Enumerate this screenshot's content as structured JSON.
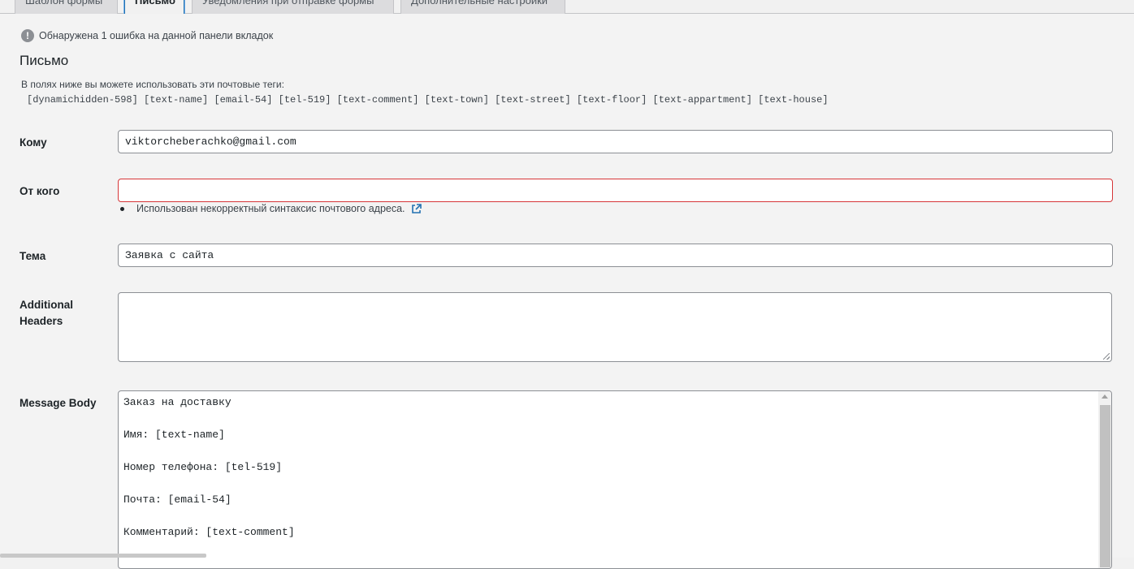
{
  "tabs": [
    {
      "label": "Шаблон формы"
    },
    {
      "label": "Письмо"
    },
    {
      "label": "Уведомления при отправке формы"
    },
    {
      "label": "Дополнительные настройки"
    }
  ],
  "error_notice": "Обнаружена 1 ошибка на данной панели вкладок",
  "section_title": "Письмо",
  "tags_intro": "В полях ниже вы можете использовать эти почтовые теги:",
  "mail_tags": "[dynamichidden-598] [text-name] [email-54] [tel-519] [text-comment] [text-town] [text-street] [text-floor] [text-appartment] [text-house]",
  "fields": {
    "to": {
      "label": "Кому",
      "value": "viktorcheberachko@gmail.com"
    },
    "from": {
      "label": "От кого",
      "value": "",
      "error": "Использован некорректный синтаксис почтового адреса."
    },
    "subject": {
      "label": "Тема",
      "value": "Заявка с сайта"
    },
    "additional_headers": {
      "label": "Additional Headers",
      "value": ""
    },
    "message_body": {
      "label": "Message Body",
      "lines": [
        "Заказ на доставку",
        "Имя: [text-name]",
        "Номер телефона: [tel-519]",
        "Почта: [email-54]",
        "Комментарий: [text-comment]"
      ]
    }
  },
  "colors": {
    "error_border": "#d63638",
    "link_blue": "#2271b1"
  }
}
